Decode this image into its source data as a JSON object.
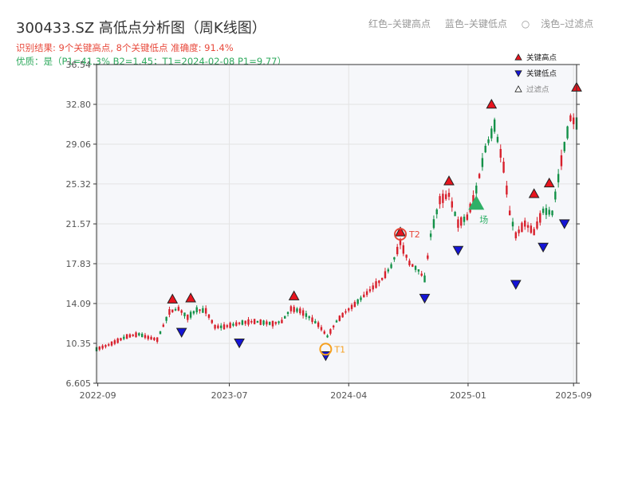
{
  "header": {
    "title": "300433.SZ 高低点分析图（周K线图）",
    "legend_red": "红色–关键高点",
    "legend_blue": "蓝色–关键低点",
    "legend_filtered": "浅色–过滤点",
    "result_line": "识别结果: 9个关键高点, 8个关键低点   准确度: 91.4%",
    "quality_line": "优质：是（P1=41.3%  B2=1.45；T1=2024-02-08 P1=9.77）"
  },
  "colors": {
    "up": "#d8202c",
    "down": "#139148",
    "high_marker": "#e8141e",
    "low_marker": "#1414d6",
    "t1": "#f5a020",
    "t2": "#e8483a",
    "signal": "#2fb067",
    "grid": "#e3e3e3",
    "plot_bg": "#f6f7fa"
  },
  "chart_data": {
    "type": "candlestick",
    "title": "",
    "y_ticks": [
      "6.605",
      "10.35",
      "14.09",
      "17.83",
      "21.57",
      "25.32",
      "29.06",
      "32.80",
      "36.54"
    ],
    "ylim": [
      6.605,
      36.54
    ],
    "x_ticks": [
      "2022-09",
      "2023-07",
      "2024-04",
      "2025-01",
      "2025-09"
    ],
    "xlim": [
      "2022-08-29",
      "2025-09-08"
    ],
    "grid": true,
    "candle_trend": [
      [
        "2022-08-29",
        9.8
      ],
      [
        "2022-09-26",
        10.2
      ],
      [
        "2022-10-17",
        10.6
      ],
      [
        "2022-11-07",
        11.0
      ],
      [
        "2022-12-05",
        11.2
      ],
      [
        "2022-12-26",
        10.9
      ],
      [
        "2023-01-16",
        10.7
      ],
      [
        "2023-02-13",
        13.3
      ],
      [
        "2023-03-06",
        13.6
      ],
      [
        "2023-03-27",
        12.8
      ],
      [
        "2023-04-17",
        13.5
      ],
      [
        "2023-05-08",
        13.4
      ],
      [
        "2023-05-29",
        11.9
      ],
      [
        "2023-06-19",
        11.9
      ],
      [
        "2023-07-10",
        12.1
      ],
      [
        "2023-07-31",
        12.3
      ],
      [
        "2023-08-28",
        12.4
      ],
      [
        "2023-09-18",
        12.3
      ],
      [
        "2023-10-09",
        12.2
      ],
      [
        "2023-10-30",
        12.4
      ],
      [
        "2023-11-20",
        13.6
      ],
      [
        "2023-12-11",
        13.4
      ],
      [
        "2024-01-01",
        12.8
      ],
      [
        "2024-01-22",
        12.1
      ],
      [
        "2024-02-12",
        11.0
      ],
      [
        "2024-03-04",
        12.4
      ],
      [
        "2024-03-25",
        13.3
      ],
      [
        "2024-04-15",
        14.0
      ],
      [
        "2024-05-06",
        14.8
      ],
      [
        "2024-05-27",
        15.6
      ],
      [
        "2024-06-17",
        16.4
      ],
      [
        "2024-07-08",
        17.6
      ],
      [
        "2024-07-29",
        19.8
      ],
      [
        "2024-08-19",
        17.9
      ],
      [
        "2024-09-09",
        17.2
      ],
      [
        "2024-09-23",
        16.4
      ],
      [
        "2024-10-07",
        20.5
      ],
      [
        "2024-10-28",
        23.8
      ],
      [
        "2024-11-18",
        24.3
      ],
      [
        "2024-12-09",
        21.6
      ],
      [
        "2024-12-30",
        22.2
      ],
      [
        "2025-01-20",
        24.8
      ],
      [
        "2025-02-10",
        28.6
      ],
      [
        "2025-03-03",
        30.8
      ],
      [
        "2025-03-24",
        26.9
      ],
      [
        "2025-04-07",
        22.6
      ],
      [
        "2025-04-21",
        20.5
      ],
      [
        "2025-05-12",
        21.6
      ],
      [
        "2025-06-02",
        20.8
      ],
      [
        "2025-06-23",
        22.8
      ],
      [
        "2025-07-14",
        22.6
      ],
      [
        "2025-08-04",
        27.5
      ],
      [
        "2025-08-25",
        31.5
      ],
      [
        "2025-09-08",
        31.0
      ]
    ],
    "key_highs": [
      {
        "date": "2023-02-20",
        "price": 13.9
      },
      {
        "date": "2023-04-03",
        "price": 14.0
      },
      {
        "date": "2023-11-27",
        "price": 14.2
      },
      {
        "date": "2024-07-29",
        "price": 20.2
      },
      {
        "date": "2024-11-18",
        "price": 25.0
      },
      {
        "date": "2025-02-24",
        "price": 32.2
      },
      {
        "date": "2025-06-02",
        "price": 23.8
      },
      {
        "date": "2025-07-07",
        "price": 24.8
      },
      {
        "date": "2025-09-08",
        "price": 33.8
      }
    ],
    "key_lows": [
      {
        "date": "2023-03-13",
        "price": 12.0
      },
      {
        "date": "2023-07-24",
        "price": 11.0
      },
      {
        "date": "2024-02-08",
        "price": 9.8
      },
      {
        "date": "2024-09-23",
        "price": 15.2
      },
      {
        "date": "2024-12-09",
        "price": 19.7
      },
      {
        "date": "2025-04-21",
        "price": 16.5
      },
      {
        "date": "2025-06-23",
        "price": 20.0
      },
      {
        "date": "2025-08-11",
        "price": 22.2
      }
    ],
    "signal": {
      "date": "2025-01-20",
      "price": 23.2,
      "label": "场"
    },
    "t1": {
      "label": "T1",
      "date": "2024-02-08",
      "price": 9.8
    },
    "t2": {
      "label": "T2",
      "date": "2024-07-29",
      "price": 20.6
    },
    "legend": {
      "high": "关键高点",
      "low": "关键低点",
      "filtered": "过滤点"
    }
  }
}
